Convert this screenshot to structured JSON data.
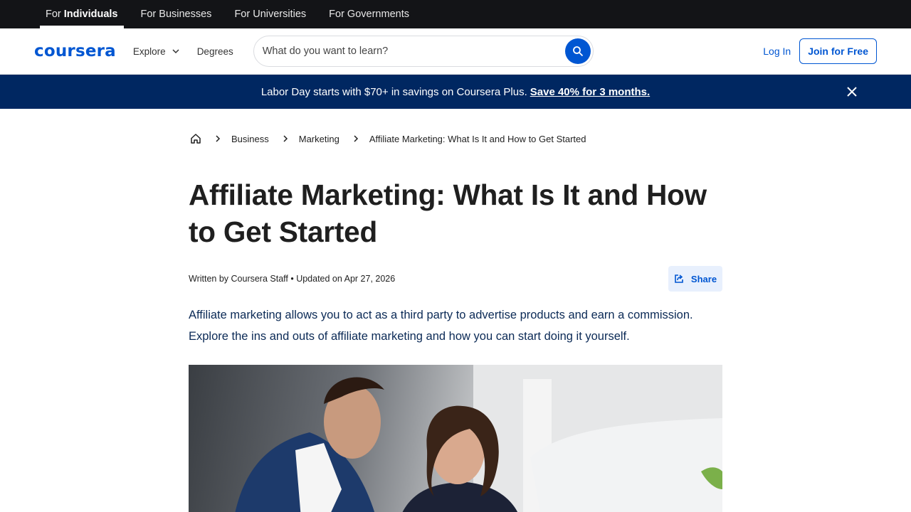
{
  "audience_tabs": [
    {
      "prefix": "For",
      "bold": "Individuals"
    },
    {
      "label": "For Businesses"
    },
    {
      "label": "For Universities"
    },
    {
      "label": "For Governments"
    }
  ],
  "header": {
    "logo": "coursera",
    "explore_label": "Explore",
    "degrees_label": "Degrees",
    "search_placeholder": "What do you want to learn?",
    "login_label": "Log In",
    "join_label": "Join for Free"
  },
  "promo": {
    "text": "Labor Day starts with $70+ in savings on Coursera Plus.",
    "link": "Save 40% for 3 months."
  },
  "breadcrumb": [
    "Business",
    "Marketing",
    "Affiliate Marketing: What Is It and How to Get Started"
  ],
  "article": {
    "title": "Affiliate Marketing: What Is It and How to Get Started",
    "meta": "Written by Coursera Staff • Updated on Apr 27, 2026",
    "share_label": "Share",
    "intro": "Affiliate marketing allows you to act as a third party to advertise products and earn a commission. Explore the ins and outs of affiliate marketing and how you can start doing it yourself."
  },
  "colors": {
    "brand": "#0056d2",
    "promo_bg": "#002761",
    "top_bar_bg": "#131417"
  },
  "icons": [
    "chevron-down-icon",
    "search-icon",
    "close-icon",
    "home-icon",
    "chevron-right-icon",
    "share-icon"
  ]
}
